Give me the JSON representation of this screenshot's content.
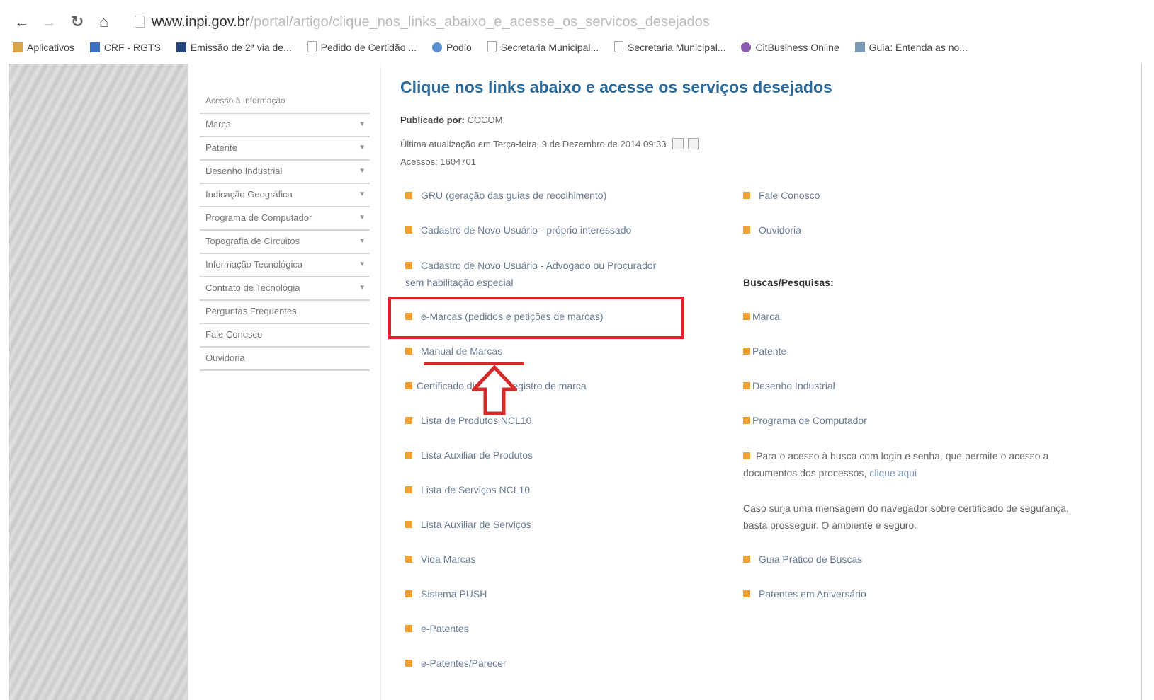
{
  "browser": {
    "url_host": "www.inpi.gov.br",
    "url_path": "/portal/artigo/clique_nos_links_abaixo_e_acesse_os_servicos_desejados",
    "bookmarks": [
      {
        "label": "Aplicativos",
        "icon": "apps-icon"
      },
      {
        "label": "CRF - RGTS",
        "icon": "bookmark-icon"
      },
      {
        "label": "Emissão de 2ª via de...",
        "icon": "bookmark-icon"
      },
      {
        "label": "Pedido de Certidão ...",
        "icon": "page-icon"
      },
      {
        "label": "Podio",
        "icon": "globe-icon"
      },
      {
        "label": "Secretaria Municipal...",
        "icon": "page-icon"
      },
      {
        "label": "Secretaria Municipal...",
        "icon": "page-icon"
      },
      {
        "label": "CitBusiness Online",
        "icon": "citi-icon"
      },
      {
        "label": "Guia: Entenda as no...",
        "icon": "bookmark-icon"
      }
    ]
  },
  "sidebar": {
    "items": [
      {
        "label": "Acesso à Informação",
        "arrow": ""
      },
      {
        "label": "Marca",
        "arrow": "▼"
      },
      {
        "label": "Patente",
        "arrow": "▼"
      },
      {
        "label": "Desenho Industrial",
        "arrow": "▼"
      },
      {
        "label": "Indicação Geográfica",
        "arrow": "▼"
      },
      {
        "label": "Programa de Computador",
        "arrow": "▼"
      },
      {
        "label": "Topografia de Circuitos",
        "arrow": "▼"
      },
      {
        "label": "Informação Tecnológica",
        "arrow": "▼"
      },
      {
        "label": "Contrato de Tecnologia",
        "arrow": "▼"
      },
      {
        "label": "Perguntas Frequentes",
        "arrow": ""
      },
      {
        "label": "Fale Conosco",
        "arrow": ""
      },
      {
        "label": "Ouvidoria",
        "arrow": ""
      }
    ]
  },
  "article": {
    "title": "Clique nos links abaixo e acesse os serviços desejados",
    "published_label": "Publicado por:",
    "published_by": "COCOM",
    "updated": "Última atualização em Terça-feira, 9 de Dezembro de 2014 09:33",
    "hits": "Acessos: 1604701"
  },
  "left_links": [
    "GRU (geração das guias de recolhimento)",
    "Cadastro de Novo Usuário - próprio interessado",
    "Cadastro de Novo Usuário - Advogado ou Procurador sem habilitação especial",
    "e-Marcas (pedidos e petições de marcas)",
    "Manual de Marcas",
    "Certificado digital de registro de marca",
    "Lista de Produtos NCL10",
    "Lista Auxiliar de Produtos",
    "Lista de Serviços NCL10",
    "Lista Auxiliar de Serviços",
    "Vida Marcas",
    "Sistema PUSH",
    "e-Patentes",
    "e-Patentes/Parecer"
  ],
  "right": {
    "links_top": [
      "Fale Conosco",
      "Ouvidoria"
    ],
    "buscas_title": "Buscas/Pesquisas:",
    "buscas_links": [
      "Marca",
      "Patente",
      "Desenho Industrial",
      "Programa de Computador"
    ],
    "login_text": "Para o acesso à busca com login e senha, que permite o acesso a documentos dos processos,",
    "login_link": "clique aqui",
    "cert_text": "Caso surja uma mensagem do navegador sobre certificado de segurança, basta prosseguir. O ambiente é seguro.",
    "links_bottom": [
      "Guia Prático de Buscas",
      "Patentes em Aniversário"
    ]
  },
  "colors": {
    "title": "#2b6a9b",
    "bullet": "#f0a030",
    "annotation": "#e0202a",
    "link": "#6a7d97"
  }
}
